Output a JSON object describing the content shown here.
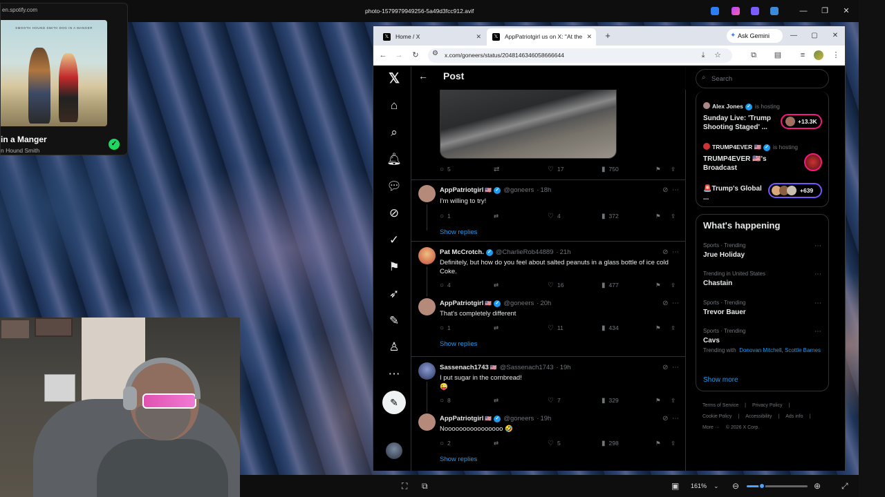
{
  "viewer": {
    "title": "photo-1579979949256-5a49d3fcc912.avif",
    "zoom": "161%",
    "zoom_fraction": 0.25
  },
  "spotify": {
    "url": "en.spotify.com",
    "art_caption": "SMOOTH HOUND SMITH   DOG IN A MANGER",
    "title": "in a Manger",
    "artist": "n Hound Smith"
  },
  "browser": {
    "tabs": [
      {
        "label": "Home / X",
        "icon": "x-logo-icon"
      },
      {
        "label": "AppPatriotgirl us on X: \"At the (",
        "icon": "x-logo-icon"
      }
    ],
    "ask_gemini": "Ask Gemini",
    "url": "x.com/goneers/status/2048146346058666644"
  },
  "post": {
    "header_title": "Post",
    "main_stats": {
      "replies": "5",
      "likes": "17",
      "views": "750"
    }
  },
  "replies": [
    {
      "name": "AppPatriotgirl",
      "flag": "🇺🇸",
      "handle": "@goneers",
      "time": "18h",
      "text": "I'm willing to try!",
      "replies": "1",
      "likes": "4",
      "views": "372",
      "show_replies": "Show replies",
      "avatar_color": "#b58a7a"
    },
    {
      "name": "Pat McCrotch.",
      "flag": "",
      "handle": "@CharlieRob44889",
      "time": "21h",
      "text": "Definitely, but how do you feel about salted peanuts in a glass bottle of ice cold Coke.",
      "replies": "4",
      "likes": "16",
      "views": "477",
      "avatar_color": "#c24a3a"
    },
    {
      "name": "AppPatriotgirl",
      "flag": "🇺🇸",
      "handle": "@goneers",
      "time": "20h",
      "text": "That's completely different",
      "replies": "1",
      "likes": "11",
      "views": "434",
      "show_replies": "Show replies",
      "avatar_color": "#b58a7a"
    },
    {
      "name": "Sassenach1743",
      "flag": "🇺🇸",
      "handle": "@Sassenach1743",
      "time": "19h",
      "text": "I put sugar in the cornbread!",
      "emoji": "😜",
      "replies": "8",
      "likes": "7",
      "views": "329",
      "avatar_color": "#4a5a8a"
    },
    {
      "name": "AppPatriotgirl",
      "flag": "🇺🇸",
      "handle": "@goneers",
      "time": "19h",
      "text": "Noooooooooooooooo 🤣",
      "replies": "2",
      "likes": "5",
      "views": "298",
      "show_replies": "Show replies",
      "avatar_color": "#b58a7a"
    }
  ],
  "search": {
    "placeholder": "Search"
  },
  "spaces": [
    {
      "host": "Alex Jones",
      "hosting": "is hosting",
      "title": "Sunday Live: 'Trump Shooting Staged' ...",
      "count": "+13.3K"
    },
    {
      "host": "TRUMP4EVER 🇺🇸",
      "hosting": "is hosting",
      "title": "TRUMP4EVER 🇺🇸's Broadcast"
    },
    {
      "host": "",
      "title": "🚨Trump's Global ...",
      "count": "+639"
    }
  ],
  "happening": {
    "title": "What's happening",
    "trends": [
      {
        "meta": "Sports · Trending",
        "name": "Jrue Holiday"
      },
      {
        "meta": "Trending in United States",
        "name": "Chastain"
      },
      {
        "meta": "Sports · Trending",
        "name": "Trevor Bauer"
      },
      {
        "meta": "Sports · Trending",
        "name": "Cavs",
        "with_prefix": "Trending with",
        "with_names": "Donovan Mitchell, Scottle Barnes"
      }
    ],
    "show_more": "Show more"
  },
  "footer": [
    "Terms of Service",
    "|",
    "Privacy Policy",
    "|",
    "Cookie Policy",
    "|",
    "Accessibility",
    "|",
    "Ads info",
    "|",
    "More ···",
    "© 2026 X Corp."
  ],
  "colors": {
    "x_blue": "#1d9bf0",
    "space_pink": "#f91880",
    "spotify_green": "#1ed760"
  }
}
